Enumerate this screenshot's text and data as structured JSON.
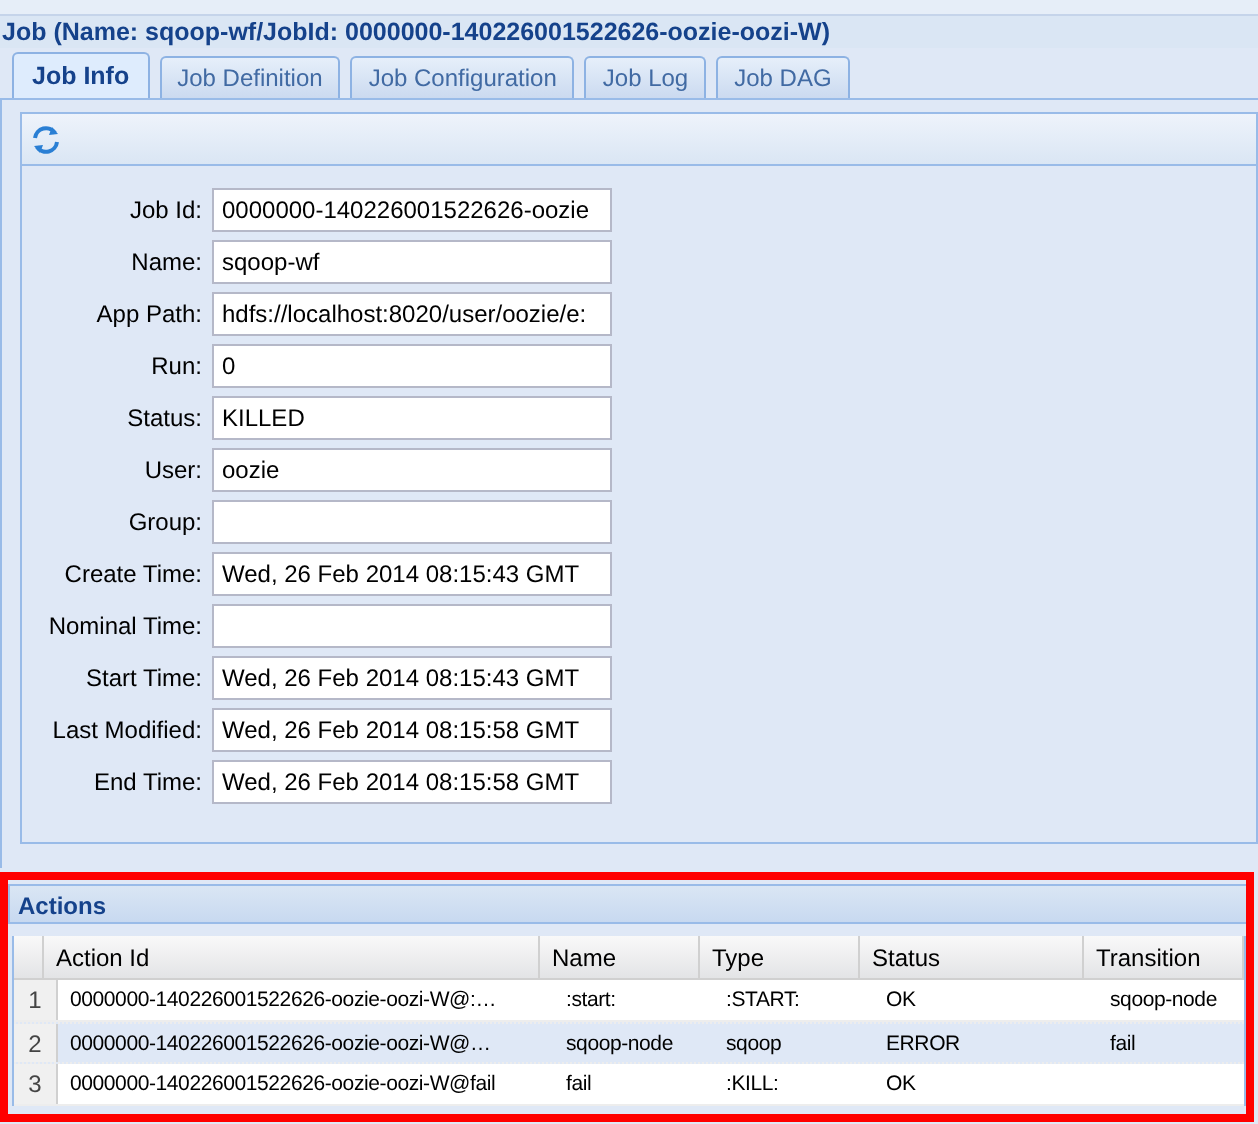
{
  "window": {
    "title": "Job (Name: sqoop-wf/JobId: 0000000-140226001522626-oozie-oozi-W)"
  },
  "tabs": [
    {
      "label": "Job Info",
      "selected": true
    },
    {
      "label": "Job Definition",
      "selected": false
    },
    {
      "label": "Job Configuration",
      "selected": false
    },
    {
      "label": "Job Log",
      "selected": false
    },
    {
      "label": "Job DAG",
      "selected": false
    }
  ],
  "fields": [
    {
      "label": "Job Id:",
      "value": "0000000-140226001522626-oozie"
    },
    {
      "label": "Name:",
      "value": "sqoop-wf"
    },
    {
      "label": "App Path:",
      "value": "hdfs://localhost:8020/user/oozie/e:"
    },
    {
      "label": "Run:",
      "value": "0"
    },
    {
      "label": "Status:",
      "value": "KILLED"
    },
    {
      "label": "User:",
      "value": "oozie"
    },
    {
      "label": "Group:"
    },
    {
      "label": "Create Time:",
      "value": "Wed, 26 Feb 2014 08:15:43 GMT"
    },
    {
      "label": "Nominal Time:"
    },
    {
      "label": "Start Time:",
      "value": "Wed, 26 Feb 2014 08:15:43 GMT"
    },
    {
      "label": "Last Modified:",
      "value": "Wed, 26 Feb 2014 08:15:58 GMT"
    },
    {
      "label": "End Time:",
      "value": "Wed, 26 Feb 2014 08:15:58 GMT"
    }
  ],
  "actions": {
    "title": "Actions",
    "columns": [
      "Action Id",
      "Name",
      "Type",
      "Status",
      "Transition"
    ],
    "rows": [
      {
        "number": "1",
        "cells": [
          "0000000-140226001522626-oozie-oozi-W@:…",
          ":start:",
          ":START:",
          "OK",
          "sqoop-node"
        ],
        "selected": false
      },
      {
        "number": "2",
        "cells": [
          "0000000-140226001522626-oozie-oozi-W@…",
          "sqoop-node",
          "sqoop",
          "ERROR",
          "fail"
        ],
        "selected": true
      },
      {
        "number": "3",
        "cells": [
          "0000000-140226001522626-oozie-oozi-W@fail",
          "fail",
          ":KILL:",
          "OK"
        ],
        "selected": false
      }
    ]
  }
}
